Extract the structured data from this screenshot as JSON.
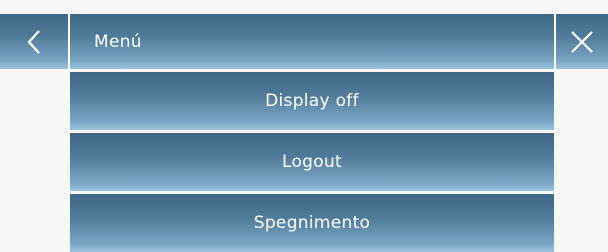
{
  "header": {
    "title": "Menú",
    "back_icon": "chevron-left-icon",
    "close_icon": "close-icon"
  },
  "menu": {
    "items": [
      {
        "label": "Display off"
      },
      {
        "label": "Logout"
      },
      {
        "label": "Spegnimento"
      }
    ]
  },
  "colors": {
    "bar_top": "#3e6785",
    "bar_bottom": "#9cc4de",
    "background": "#f7f7f7",
    "text": "#ffffff"
  }
}
